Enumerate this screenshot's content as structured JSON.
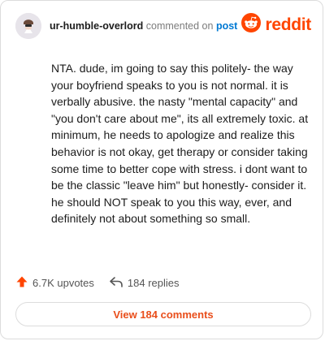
{
  "header": {
    "username": "ur-humble-overlord",
    "action_text": "commented on",
    "post_link": "post",
    "brand": "reddit"
  },
  "comment": {
    "body": "NTA. dude, im going to say this politely- the way your boyfriend speaks to you is not normal. it is verbally abusive. the nasty \"mental capacity\" and \"you don't care about me\", its all extremely toxic. at minimum, he needs to apologize and realize this behavior is not okay, get therapy or consider taking some time to better cope with stress. i dont want to be the classic \"leave him\" but honestly- consider it. he should NOT speak to you this way, ever, and definitely not about something so small."
  },
  "actions": {
    "upvotes": "6.7K upvotes",
    "replies": "184 replies"
  },
  "view_comments_label": "View 184 comments",
  "icons": {
    "upvote": "upvote-arrow-icon",
    "reply": "reply-arrow-icon",
    "brand": "reddit-snoo-icon"
  },
  "colors": {
    "brand": "#ff4500",
    "link": "#0079d3",
    "button_text": "#e94e1b"
  }
}
